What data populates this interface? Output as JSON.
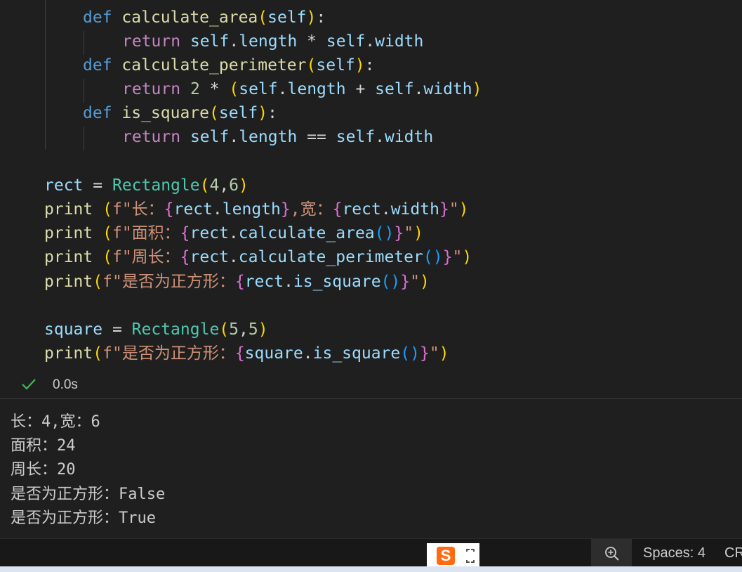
{
  "code": {
    "def_kw": "def",
    "self_kw": "self",
    "return_kw": "return",
    "print_kw": "print",
    "class_name": "Rectangle",
    "fn_calculate_area": "calculate_area",
    "fn_calculate_perimeter": "calculate_perimeter",
    "fn_is_square": "is_square",
    "attr_length": "length",
    "attr_width": "width",
    "var_rect": "rect",
    "var_square": "square",
    "num_2": "2",
    "num_4": "4",
    "num_6": "6",
    "num_5": "5",
    "str_prefix": "f\"",
    "str_quote": "\"",
    "str_long": "长：",
    "str_wide": ",宽：",
    "str_area": "面积：",
    "str_perimeter": "周长：",
    "str_is_square": "是否为正方形："
  },
  "cell_status": {
    "check_icon": "check-icon",
    "duration": "0.0s"
  },
  "output": {
    "lines": [
      "长：4,宽：6",
      "面积：24",
      "周长：20",
      "是否为正方形：False",
      "是否为正方形：True"
    ]
  },
  "statusbar": {
    "ime_icon": "sogou-ime-icon",
    "zoom_icon": "zoom-in-icon",
    "spaces": "Spaces: 4",
    "line_ending": "CRLF"
  }
}
